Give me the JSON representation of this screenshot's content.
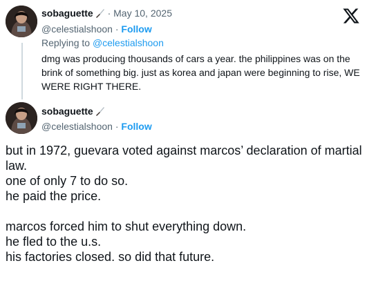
{
  "quoted_tweet": {
    "author_name": "sobaguette",
    "emoji": "knife-emoji",
    "separator": "·",
    "date": "May 10, 2025",
    "handle": "@celestialshoon",
    "dot": "·",
    "follow_label": "Follow",
    "replying_prefix": "Replying to",
    "replying_handle": "@celestialshoon",
    "text": "dmg was producing thousands of cars a year. the philippines was on the brink of something big. just as korea and japan were beginning to rise, WE WERE RIGHT THERE."
  },
  "main_tweet": {
    "author_name": "sobaguette",
    "emoji": "knife-emoji",
    "handle": "@celestialshoon",
    "dot": "·",
    "follow_label": "Follow",
    "lines": [
      "but in 1972, guevara voted against marcos’ declaration of martial law.",
      "one of only 7 to do so.",
      "he paid the price.",
      "",
      "marcos forced him to shut everything down.",
      "he fled to the u.s.",
      "his factories closed. so did that future."
    ]
  },
  "brand": {
    "logo": "x-logo-icon"
  },
  "colors": {
    "text": "#0f1419",
    "muted": "#536471",
    "link": "#1d9bf0",
    "thread_line": "#cfd9de"
  }
}
